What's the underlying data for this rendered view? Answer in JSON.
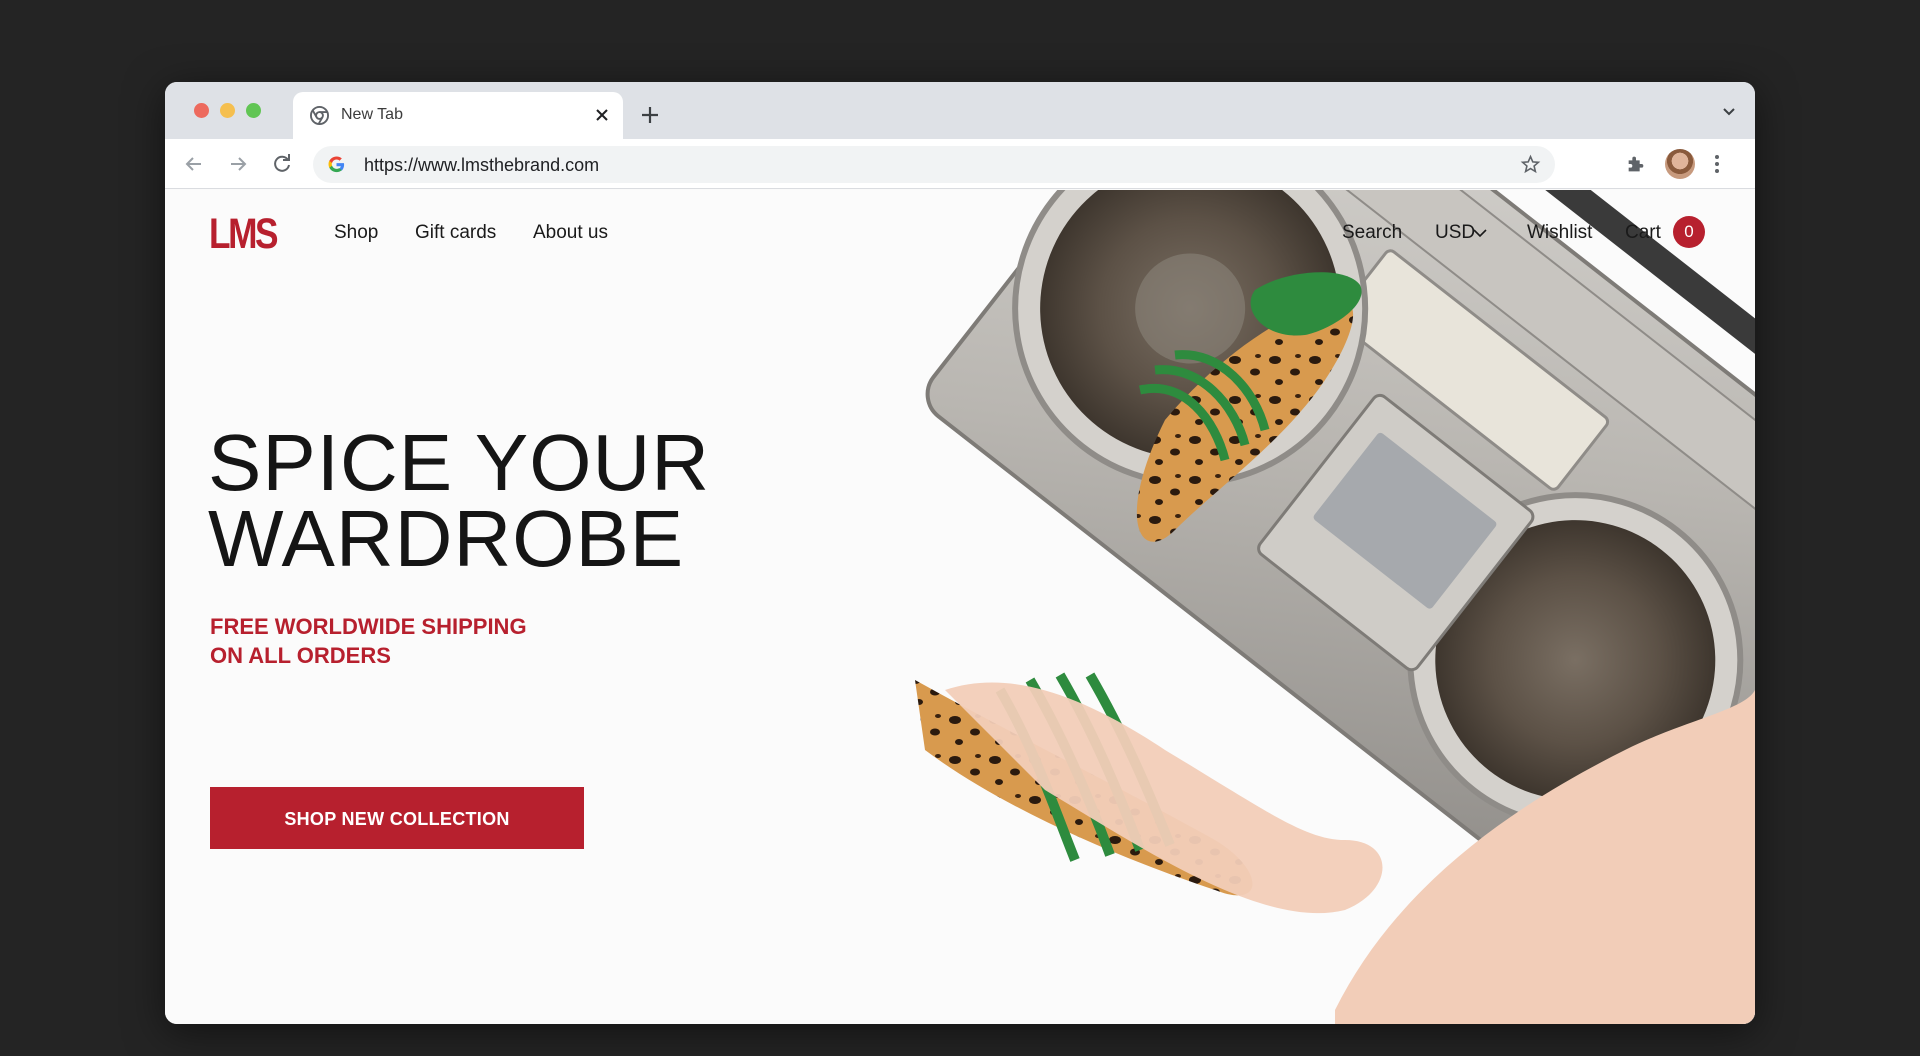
{
  "browser": {
    "tab": {
      "title": "New Tab",
      "favicon": "chrome-icon"
    },
    "address_bar": {
      "url": "https://www.lmsthebrand.com"
    }
  },
  "site": {
    "logo": "LMS",
    "nav_left": [
      "Shop",
      "Gift cards",
      "About us"
    ],
    "nav_right": {
      "search": "Search",
      "currency": "USD",
      "wishlist": "Wishlist",
      "cart": "Cart",
      "cart_count": "0"
    },
    "hero": {
      "headline_line1": "SPICE YOUR",
      "headline_line2": "WARDROBE",
      "subhead_line1": "FREE WORLDWIDE SHIPPING",
      "subhead_line2": "ON ALL ORDERS",
      "cta": "SHOP NEW COLLECTION",
      "image": "boombox-with-leopard-print-sandals-photo"
    }
  },
  "colors": {
    "brand_red": "#b7202e",
    "background": "#242424",
    "page_bg": "#fbfbfb",
    "tabstrip": "#dee1e6",
    "sandal_green": "#2e8b3e"
  }
}
